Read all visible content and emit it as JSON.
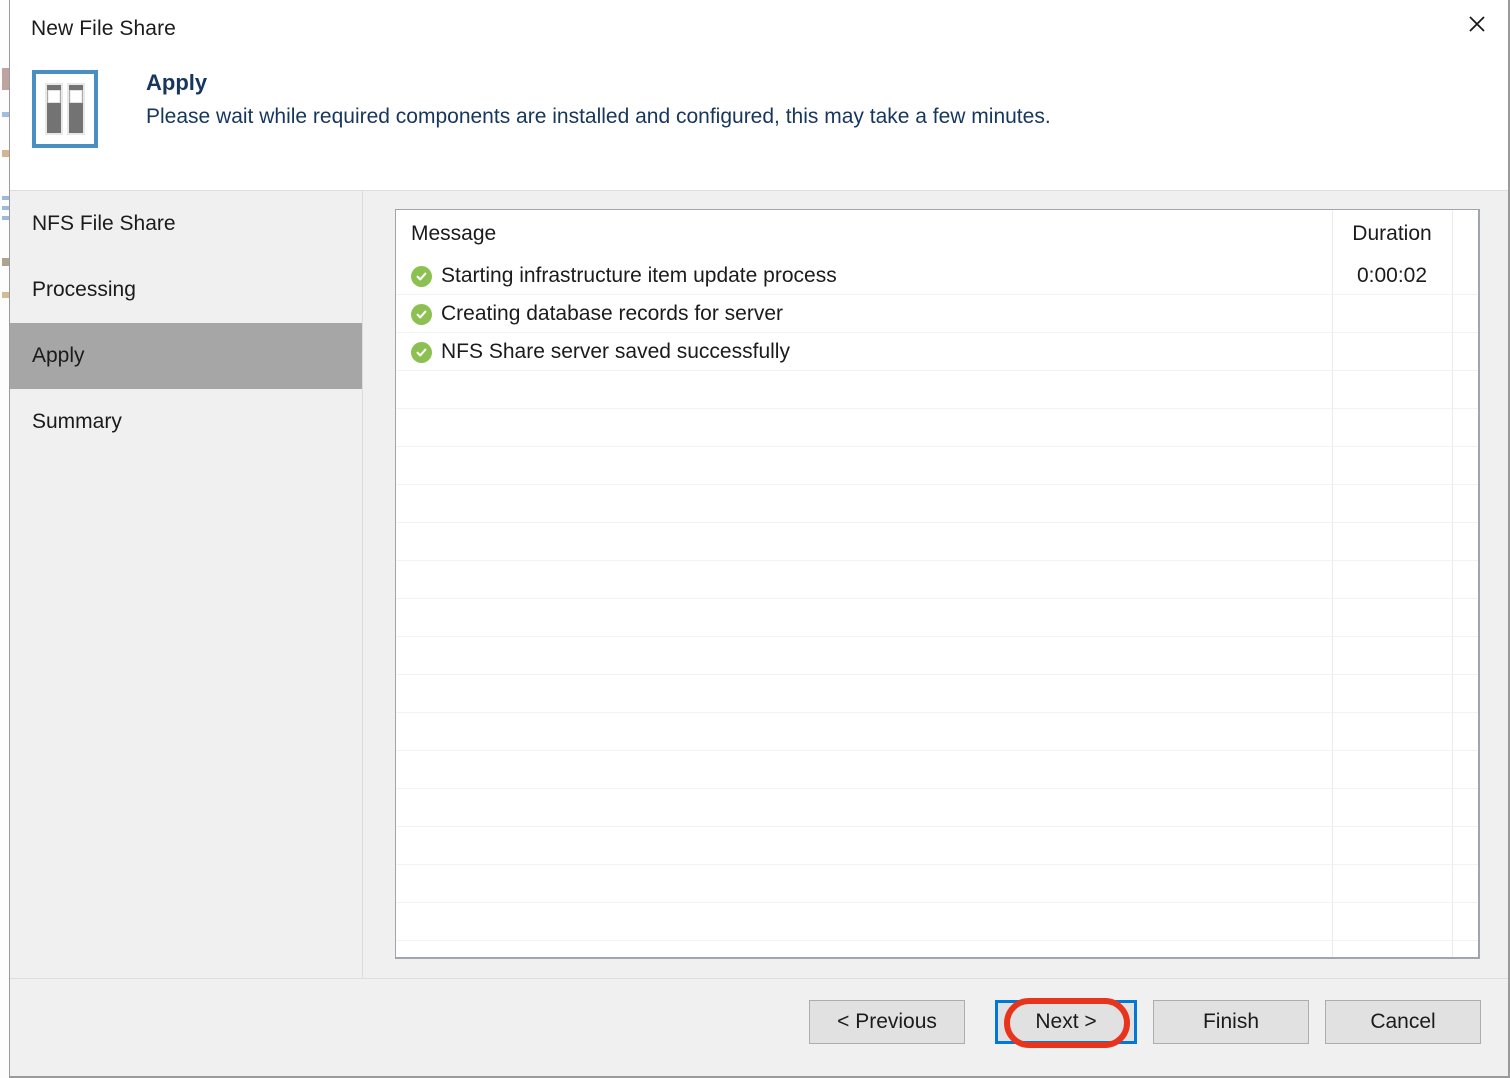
{
  "window": {
    "title": "New File Share",
    "close_icon": "close-icon"
  },
  "header": {
    "icon": "file-share-server-icon",
    "title": "Apply",
    "description": "Please wait while required components are installed and configured, this may take a few minutes."
  },
  "sidebar": {
    "items": [
      {
        "label": "NFS File Share",
        "active": false
      },
      {
        "label": "Processing",
        "active": false
      },
      {
        "label": "Apply",
        "active": true
      },
      {
        "label": "Summary",
        "active": false
      }
    ]
  },
  "list": {
    "columns": {
      "message": "Message",
      "duration": "Duration"
    },
    "rows": [
      {
        "status_icon": "success-check-icon",
        "message": "Starting infrastructure item update process",
        "duration": "0:00:02"
      },
      {
        "status_icon": "success-check-icon",
        "message": "Creating database records for server",
        "duration": ""
      },
      {
        "status_icon": "success-check-icon",
        "message": "NFS Share server saved successfully",
        "duration": ""
      }
    ],
    "empty_row_count": 16
  },
  "footer": {
    "previous_label": "< Previous",
    "next_label": "Next >",
    "finish_label": "Finish",
    "cancel_label": "Cancel"
  },
  "annotation": {
    "target": "next-button",
    "shape": "oval",
    "color": "#e8341c"
  },
  "colors": {
    "accent_blue": "#0078d7",
    "icon_blue": "#4a8fc4",
    "heading_text": "#17365d",
    "success_green": "#8cc152",
    "sidebar_bg": "#f0f0f0",
    "active_item_bg": "#a6a6a6",
    "annotation_red": "#e8341c"
  }
}
